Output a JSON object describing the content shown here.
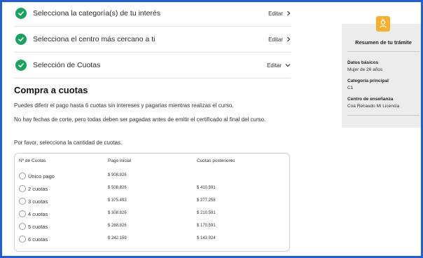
{
  "steps": [
    {
      "title": "Selecciona la categoría(s) de tu interés",
      "edit": "Editar"
    },
    {
      "title": "Selecciona el centro más cercano a ti",
      "edit": "Editar"
    },
    {
      "title": "Selección de Cuotas",
      "edit": "Editar"
    }
  ],
  "section": {
    "title": "Compra a cuotas",
    "p1": "Puedes diferir el pago hasta 6 cuotas sin intereses y pagarlas mientras realizas el curso.",
    "p2": "No hay fechas de corte, pero todas deben ser pagadas antes de emitir el certificado al final del curso.",
    "p3": "Por favor, selecciona la cantidad de cuotas."
  },
  "table": {
    "headers": [
      "Nº de Cuotas",
      "Pago inicial",
      "Cuotas posteriores"
    ],
    "rows": [
      {
        "label": "Único pago",
        "initial": "$ 908.826",
        "later": ""
      },
      {
        "label": "2 cuotas",
        "initial": "$ 508.826",
        "later": "$ 410.591"
      },
      {
        "label": "3 cuotas",
        "initial": "$ 375.493",
        "later": "$ 277.258"
      },
      {
        "label": "4 cuotas",
        "initial": "$ 308.826",
        "later": "$ 210.591"
      },
      {
        "label": "5 cuotas",
        "initial": "$ 268.826",
        "later": "$ 170.591"
      },
      {
        "label": "6 cuotas",
        "initial": "$ 242.159",
        "later": "$ 143.924"
      }
    ]
  },
  "summary": {
    "title": "Resumen de tu trámite",
    "items": [
      {
        "key": "Datos básicos",
        "value": "Mujer de 26 años"
      },
      {
        "key": "Categoría principal",
        "value": "C1"
      },
      {
        "key": "Centro de enseñanza",
        "value": "Coa Recaudo Mi Licencia"
      }
    ],
    "badge_icon": "id-badge-icon",
    "badge_color": "#f6b02b"
  },
  "colors": {
    "check": "#1aa260",
    "frame": "#1f5fd8"
  }
}
